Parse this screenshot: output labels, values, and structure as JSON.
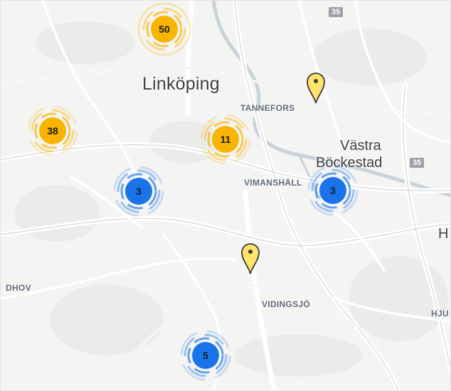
{
  "map": {
    "labels": {
      "linkoping": "Linköping",
      "tannefors": "TANNEFORS",
      "vastra_line1": "Västra",
      "vastra_line2": "Böckestad",
      "vimanshall": "VIMANSHÄLL",
      "vidingsjo": "VIDINGSJÖ",
      "dhov": "DHOV",
      "hju": "HJU",
      "h_partial": "H"
    },
    "road_shields": {
      "top": "35",
      "right": "35"
    }
  },
  "clusters": [
    {
      "id": "cluster-50",
      "count": "50",
      "color": "yellow"
    },
    {
      "id": "cluster-38",
      "count": "38",
      "color": "yellow"
    },
    {
      "id": "cluster-11",
      "count": "11",
      "color": "yellow"
    },
    {
      "id": "cluster-3-west",
      "count": "3",
      "color": "blue"
    },
    {
      "id": "cluster-3-east",
      "count": "3",
      "color": "blue"
    },
    {
      "id": "cluster-5",
      "count": "5",
      "color": "blue"
    }
  ],
  "colors": {
    "cluster_yellow": "#f9b400",
    "cluster_blue": "#1a73e8",
    "pin_yellow": "#ffe36b",
    "map_background": "#f4f4f3",
    "water": "#c9d3da"
  },
  "pins": [
    {
      "id": "pin-north-east",
      "icon": "map-pin-icon"
    },
    {
      "id": "pin-south",
      "icon": "map-pin-icon"
    }
  ]
}
